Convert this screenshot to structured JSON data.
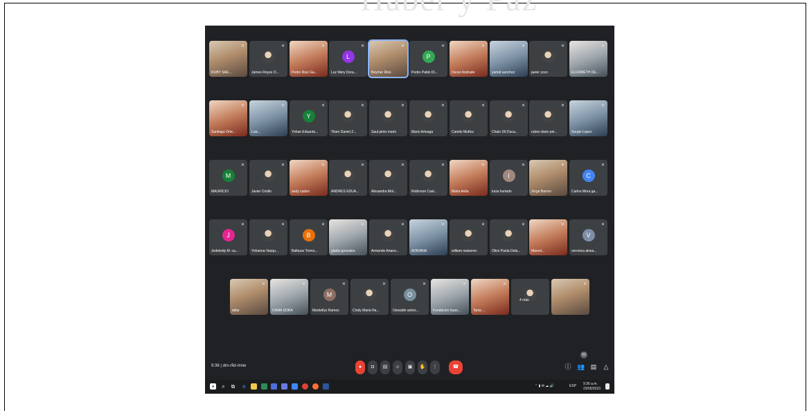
{
  "meeting": {
    "time": "9:36",
    "separator": "|",
    "code": "drn-rfid-mnw"
  },
  "tiles": [
    {
      "name": "RUBY SAIL...",
      "kind": "photo",
      "avatar": "",
      "color": ""
    },
    {
      "name": "James Reyes O...",
      "kind": "icon",
      "avatar": "",
      "color": ""
    },
    {
      "name": "Pedro Ruiz Ga...",
      "kind": "photo",
      "avatar": "",
      "color": ""
    },
    {
      "name": "Luz Mery Dora...",
      "kind": "letter",
      "avatar": "L",
      "color": "#9334e6"
    },
    {
      "name": "Beymer Rios",
      "kind": "photo",
      "avatar": "",
      "color": ""
    },
    {
      "name": "Pedro Pablo Di...",
      "kind": "letter",
      "avatar": "P",
      "color": "#34a853"
    },
    {
      "name": "Oscar Andrade",
      "kind": "photo",
      "avatar": "",
      "color": ""
    },
    {
      "name": "yamid sanchez",
      "kind": "photo",
      "avatar": "",
      "color": ""
    },
    {
      "name": "javier yoco",
      "kind": "icon",
      "avatar": "",
      "color": ""
    },
    {
      "name": "ELIZABETH DE...",
      "kind": "photo",
      "avatar": "",
      "color": ""
    },
    {
      "name": "Santiago Orte...",
      "kind": "photo",
      "avatar": "",
      "color": ""
    },
    {
      "name": "Luis...",
      "kind": "photo",
      "avatar": "",
      "color": ""
    },
    {
      "name": "Yohan Eduardo...",
      "kind": "letter",
      "avatar": "Y",
      "color": "#188038"
    },
    {
      "name": "Yilam Daniel Z...",
      "kind": "icon",
      "avatar": "",
      "color": ""
    },
    {
      "name": "Saul pinto marin",
      "kind": "icon",
      "avatar": "",
      "color": ""
    },
    {
      "name": "Mario Arteaga",
      "kind": "icon",
      "avatar": "",
      "color": ""
    },
    {
      "name": "Camilo Muñoz",
      "kind": "icon",
      "avatar": "",
      "color": ""
    },
    {
      "name": "Chalo Oli Duca...",
      "kind": "icon",
      "avatar": "",
      "color": ""
    },
    {
      "name": "ruben dario pel...",
      "kind": "icon",
      "avatar": "",
      "color": ""
    },
    {
      "name": "Sergio Lopez",
      "kind": "photo",
      "avatar": "",
      "color": ""
    },
    {
      "name": "MAURICIO",
      "kind": "letter",
      "avatar": "M",
      "color": "#188038"
    },
    {
      "name": "Javier Criollo",
      "kind": "icon",
      "avatar": "",
      "color": ""
    },
    {
      "name": "andy castro",
      "kind": "photo",
      "avatar": "",
      "color": ""
    },
    {
      "name": "ANDRES EDUA...",
      "kind": "icon",
      "avatar": "",
      "color": ""
    },
    {
      "name": "Alexandra Mol...",
      "kind": "icon",
      "avatar": "",
      "color": ""
    },
    {
      "name": "Robinson Cast...",
      "kind": "icon",
      "avatar": "",
      "color": ""
    },
    {
      "name": "Maira Avila",
      "kind": "photo",
      "avatar": "",
      "color": ""
    },
    {
      "name": "lucia hurtado",
      "kind": "letter",
      "avatar": "l",
      "color": "#a1887f"
    },
    {
      "name": "Jorge Barron",
      "kind": "photo",
      "avatar": "",
      "color": ""
    },
    {
      "name": "Carlos Mora ga...",
      "kind": "letter",
      "avatar": "C",
      "color": "#4285f4"
    },
    {
      "name": "Jedeleidy M. ca...",
      "kind": "letter",
      "avatar": "J",
      "color": "#e52592"
    },
    {
      "name": "Yohanna Vasqu...",
      "kind": "icon",
      "avatar": "",
      "color": ""
    },
    {
      "name": "Baltazar Tormo...",
      "kind": "letter",
      "avatar": "B",
      "color": "#e8710a"
    },
    {
      "name": "gladis gonzales",
      "kind": "photo",
      "avatar": "",
      "color": ""
    },
    {
      "name": "Armando Ariano...",
      "kind": "icon",
      "avatar": "",
      "color": ""
    },
    {
      "name": "ADRIANA",
      "kind": "photo",
      "avatar": "",
      "color": ""
    },
    {
      "name": "william maturner",
      "kind": "icon",
      "avatar": "",
      "color": ""
    },
    {
      "name": "Olivo Paola Dela...",
      "kind": "icon",
      "avatar": "",
      "color": ""
    },
    {
      "name": "Marvel...",
      "kind": "photo",
      "avatar": "",
      "color": ""
    },
    {
      "name": "veronica alvea...",
      "kind": "letter",
      "avatar": "V",
      "color": "#7e8ea6"
    },
    {
      "name": "tallar",
      "kind": "photo",
      "avatar": "",
      "color": ""
    },
    {
      "name": "CAMA SORA",
      "kind": "photo",
      "avatar": "",
      "color": ""
    },
    {
      "name": "Marbellys Ramos",
      "kind": "letter",
      "avatar": "M",
      "color": "#8d6e63"
    },
    {
      "name": "Cindy Maria Ra...",
      "kind": "icon",
      "avatar": "",
      "color": ""
    },
    {
      "name": "Oswaldo anton...",
      "kind": "letter",
      "avatar": "O",
      "color": "#78909c"
    },
    {
      "name": "Fundacion huas...",
      "kind": "photo",
      "avatar": "",
      "color": ""
    },
    {
      "name": "Tania ...",
      "kind": "photo",
      "avatar": "",
      "color": ""
    },
    {
      "name": "4 más",
      "kind": "more",
      "avatar": "",
      "color": ""
    },
    {
      "name": "",
      "kind": "photo",
      "avatar": "",
      "color": ""
    }
  ],
  "controls": {
    "badge": "52"
  },
  "tray": {
    "clock": "9:36 a.m.",
    "date": "23/05/2023",
    "lang": "ESP"
  }
}
